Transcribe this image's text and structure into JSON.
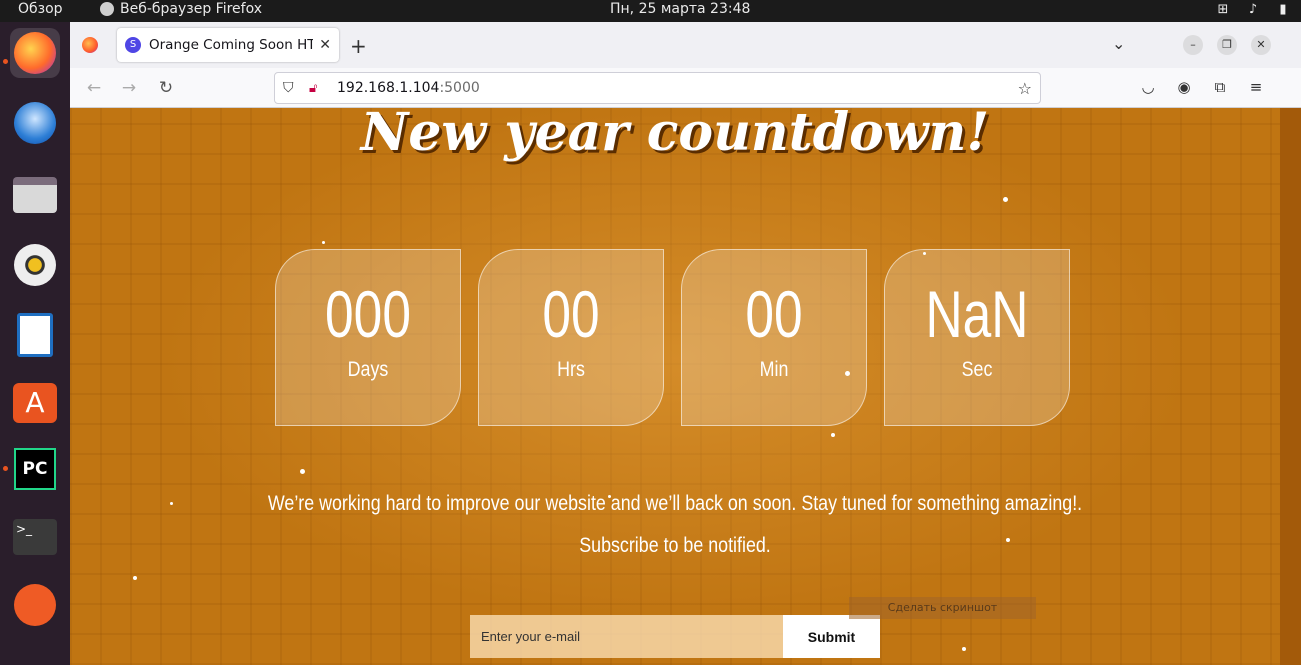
{
  "topbar": {
    "overview": "Обзор",
    "app_name": "Веб-браузер Firefox",
    "clock": "Пн, 25 марта  23:48"
  },
  "dock": {
    "items": [
      "firefox",
      "thunderbird",
      "files",
      "rhythmbox",
      "libreoffice-writer",
      "app-center",
      "pycharm",
      "terminal",
      "postman"
    ]
  },
  "browser": {
    "tab_title": "Orange Coming Soon HTML",
    "tab_favicon": "S",
    "new_tab": "+",
    "url_host": "192.168.1.104",
    "url_port": ":5000"
  },
  "page": {
    "heading": "New year countdown!",
    "countdown": [
      {
        "value": "000",
        "unit": "Days"
      },
      {
        "value": "00",
        "unit": "Hrs"
      },
      {
        "value": "00",
        "unit": "Min"
      },
      {
        "value": "NaN",
        "unit": "Sec"
      }
    ],
    "message": "We’re working hard to improve our website and we’ll back on soon. Stay tuned for something amazing!.",
    "subscribe": "Subscribe to be notified.",
    "email_placeholder": "Enter your e-mail",
    "submit_label": "Submit",
    "screenshot_tip": "Сделать скриншот"
  },
  "colors": {
    "background": "#c07512",
    "accent": "#e95420"
  }
}
